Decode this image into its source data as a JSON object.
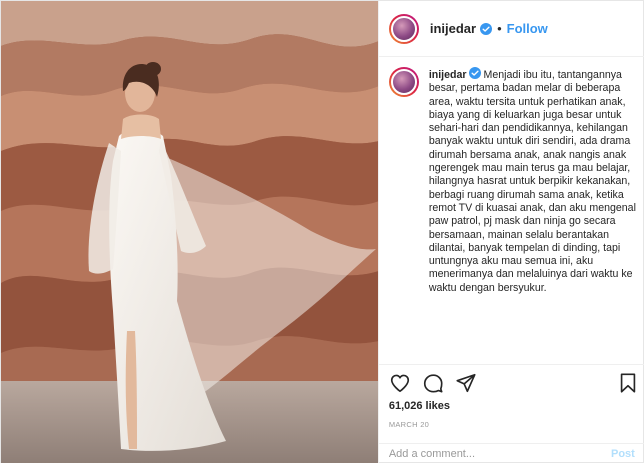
{
  "header": {
    "username": "inijedar",
    "follow_label": "Follow",
    "dot": "•"
  },
  "caption": {
    "username": "inijedar",
    "text": "Menjadi ibu itu, tantangannya besar, pertama badan melar di beberapa area, waktu tersita untuk perhatikan anak, biaya yang di keluarkan juga besar untuk sehari-hari dan pendidikannya, kehilangan banyak waktu untuk diri sendiri, ada drama dirumah bersama anak, anak nangis anak ngerengek mau main terus ga mau belajar, hilangnya hasrat untuk berpikir kekanakan, berbagi ruang dirumah sama anak, ketika remot TV di kuasai anak, dan aku mengenal paw patrol, pj mask dan ninja go secara bersamaan, mainan selalu berantakan dilantai, banyak tempelan di dinding, tapi untungnya aku mau semua ini, aku menerimanya dan melaluinya dari waktu ke waktu dengan bersyukur."
  },
  "engagement": {
    "likes": "61,026 likes",
    "date": "MARCH 20"
  },
  "comment": {
    "placeholder": "Add a comment...",
    "post_label": "Post"
  },
  "icons": {
    "like": "heart-icon",
    "comment": "comment-icon",
    "share": "share-icon",
    "save": "bookmark-icon",
    "verified": "verified-badge-icon"
  },
  "colors": {
    "follow": "#3897f0",
    "verified": "#3897f0",
    "post_disabled": "#b2dffc",
    "photo_wall": "#a9664d"
  }
}
